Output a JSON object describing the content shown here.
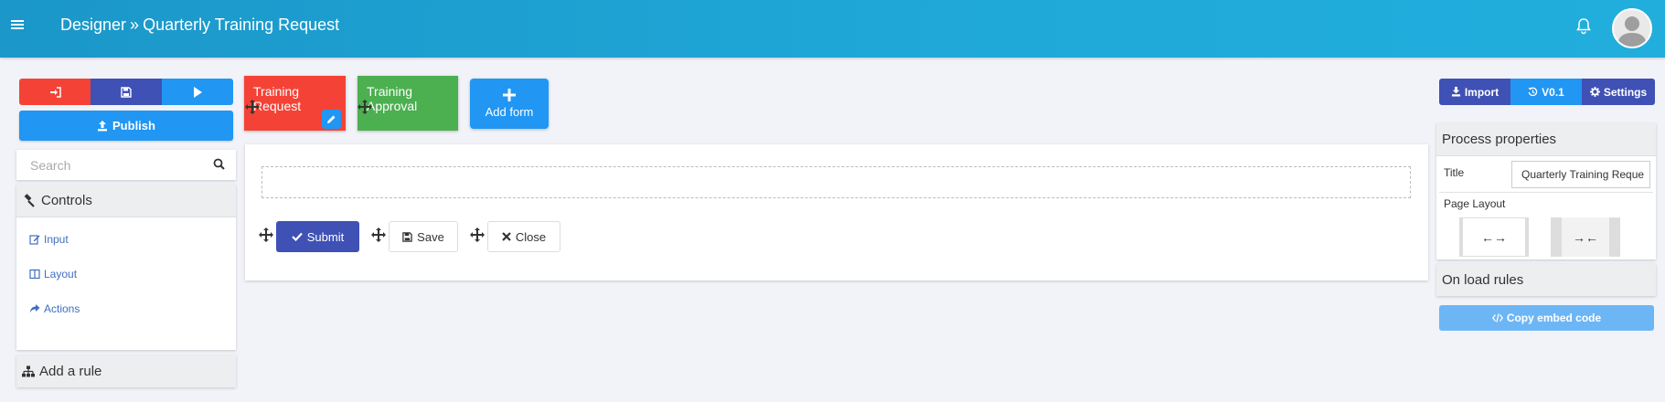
{
  "header": {
    "root": "Designer",
    "separator": "»",
    "title": "Quarterly Training Request"
  },
  "left_panel": {
    "publish_label": "Publish",
    "search_placeholder": "Search",
    "controls_title": "Controls",
    "controls": [
      {
        "label": "Input",
        "icon": "edit-icon"
      },
      {
        "label": "Layout",
        "icon": "columns-icon"
      },
      {
        "label": "Actions",
        "icon": "share-icon"
      }
    ],
    "add_rule_label": "Add a rule"
  },
  "tabs": [
    {
      "label": "Training Request",
      "color": "#f44336"
    },
    {
      "label": "Training Approval",
      "color": "#4caf50"
    }
  ],
  "add_form_label": "Add form",
  "form_buttons": {
    "submit": "Submit",
    "save": "Save",
    "close": "Close"
  },
  "right_panel": {
    "import_label": "Import",
    "version_label": "V0.1",
    "settings_label": "Settings",
    "process_properties_title": "Process properties",
    "title_label": "Title",
    "title_value": "Quarterly Training Reque",
    "page_layout_label": "Page Layout",
    "layout_wide_glyph": "←→",
    "layout_narrow_glyph": "→←",
    "on_load_rules_title": "On load rules",
    "copy_embed_label": "Copy embed code"
  },
  "colors": {
    "header": "#1fa9d9",
    "red": "#f44336",
    "indigo": "#3f51b5",
    "blue": "#2196f3",
    "green": "#4caf50"
  }
}
